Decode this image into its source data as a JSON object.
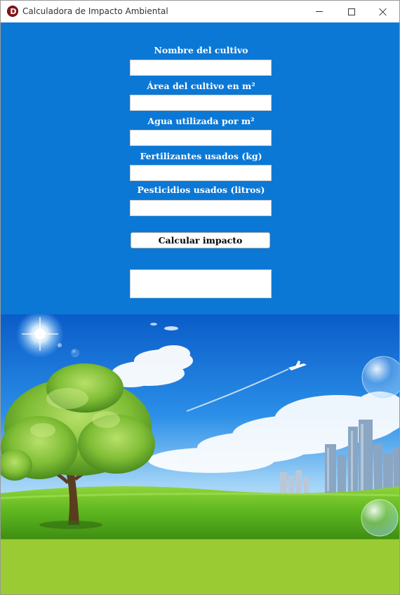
{
  "window": {
    "title": "Calculadora de Impacto Ambiental",
    "app_icon_letter": "D",
    "controls": [
      "minimize",
      "maximize",
      "close"
    ]
  },
  "form": {
    "crop_name_label": "Nombre del cultivo",
    "crop_area_label": "Área del cultivo en m²",
    "water_label": "Agua utilizada por m²",
    "fertilizer_label": "Fertilizantes usados (kg)",
    "pesticide_label": "Pesticidios usados (litros)",
    "crop_name_value": "",
    "crop_area_value": "",
    "water_value": "",
    "fertilizer_value": "",
    "pesticide_value": "",
    "calculate_button": "Calcular impacto",
    "result_text": ""
  },
  "colors": {
    "form_background": "#0b78d6",
    "bottom_bar": "#9acb32",
    "app_icon": "#8b1414"
  }
}
